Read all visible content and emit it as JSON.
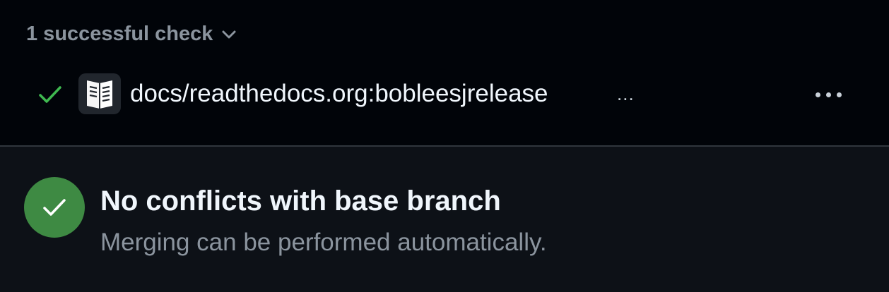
{
  "checks": {
    "summary_label": "1 successful check",
    "summary_icon": "chevron-down-icon",
    "items": [
      {
        "status_icon": "check-icon",
        "app_icon": "readthedocs-logo-icon",
        "name": "docs/readthedocs.org:bobleesjrelease",
        "ellipsis": "...",
        "menu_icon": "kebab-horizontal-icon"
      }
    ]
  },
  "merge_status": {
    "icon": "check-circle-icon",
    "title": "No conflicts with base branch",
    "subtitle": "Merging can be performed automatically."
  },
  "colors": {
    "success_green": "#3e8a43",
    "check_green": "#3fb950",
    "muted_text": "#8b949e",
    "primary_text": "#f0f6fc",
    "top_background": "#010409",
    "bottom_background": "#0d1117"
  }
}
